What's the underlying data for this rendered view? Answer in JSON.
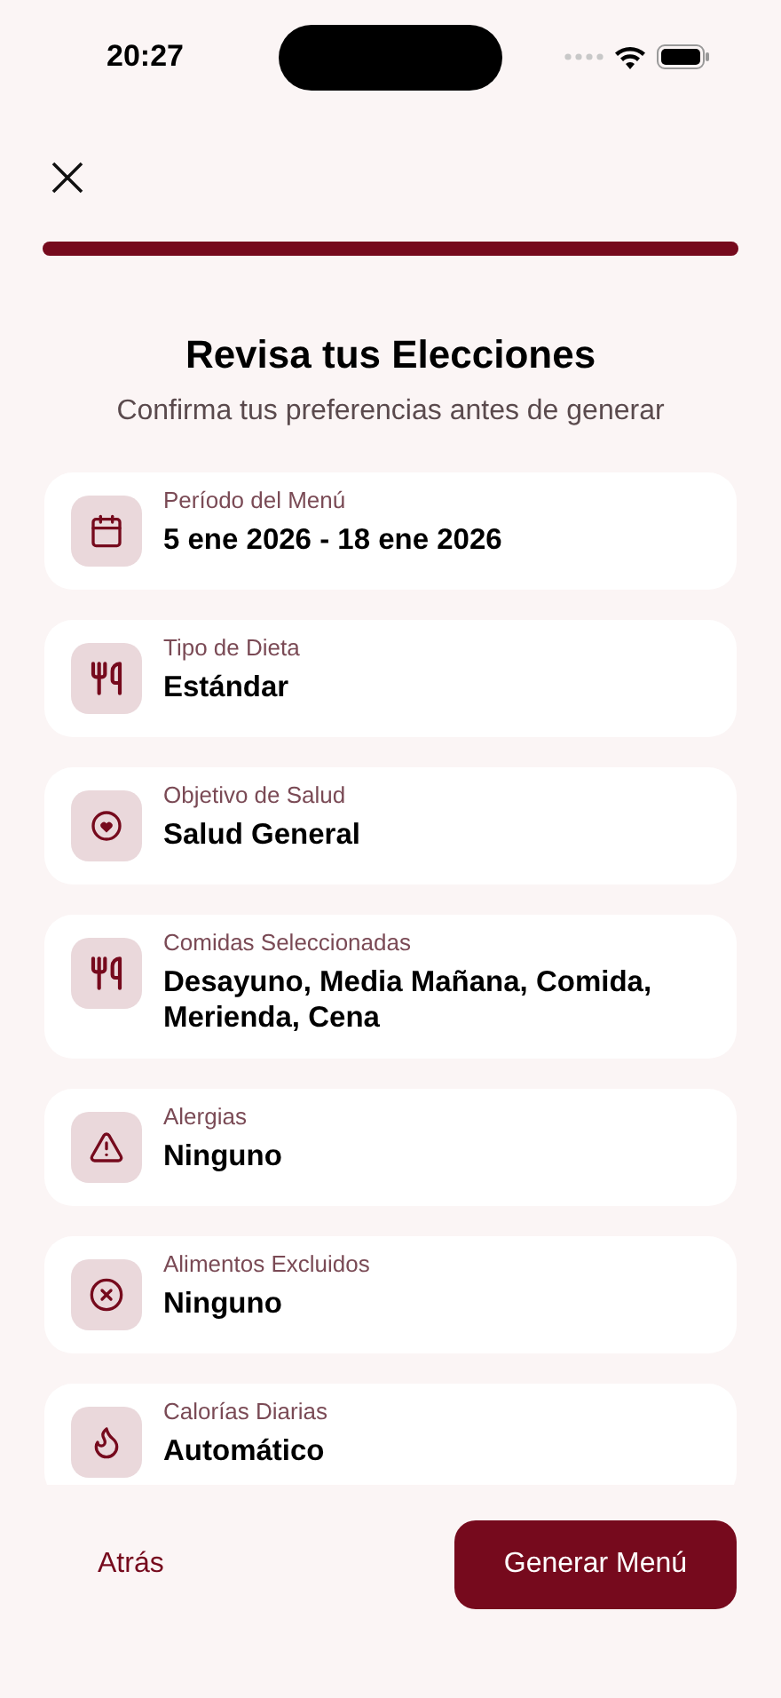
{
  "status_bar": {
    "time": "20:27"
  },
  "progress": {
    "level": 1
  },
  "title": "Revisa tus Elecciones",
  "subtitle": "Confirma tus preferencias antes de generar",
  "items": [
    {
      "kind": "calendar",
      "label": "Período del Menú",
      "value": "5 ene 2026 - 18 ene 2026"
    },
    {
      "kind": "utensils",
      "label": "Tipo de Dieta",
      "value": "Estándar"
    },
    {
      "kind": "heart",
      "label": "Objetivo de Salud",
      "value": "Salud General"
    },
    {
      "kind": "utensils",
      "label": "Comidas Seleccionadas",
      "value": "Desayuno, Media Mañana, Comida, Merienda, Cena"
    },
    {
      "kind": "warning",
      "label": "Alergias",
      "value": "Ninguno"
    },
    {
      "kind": "excluded",
      "label": "Alimentos Excluidos",
      "value": "Ninguno"
    },
    {
      "kind": "flame",
      "label": "Calorías Diarias",
      "value": "Automático"
    }
  ],
  "buttons": {
    "back": "Atrás",
    "generate": "Generar Menú"
  }
}
